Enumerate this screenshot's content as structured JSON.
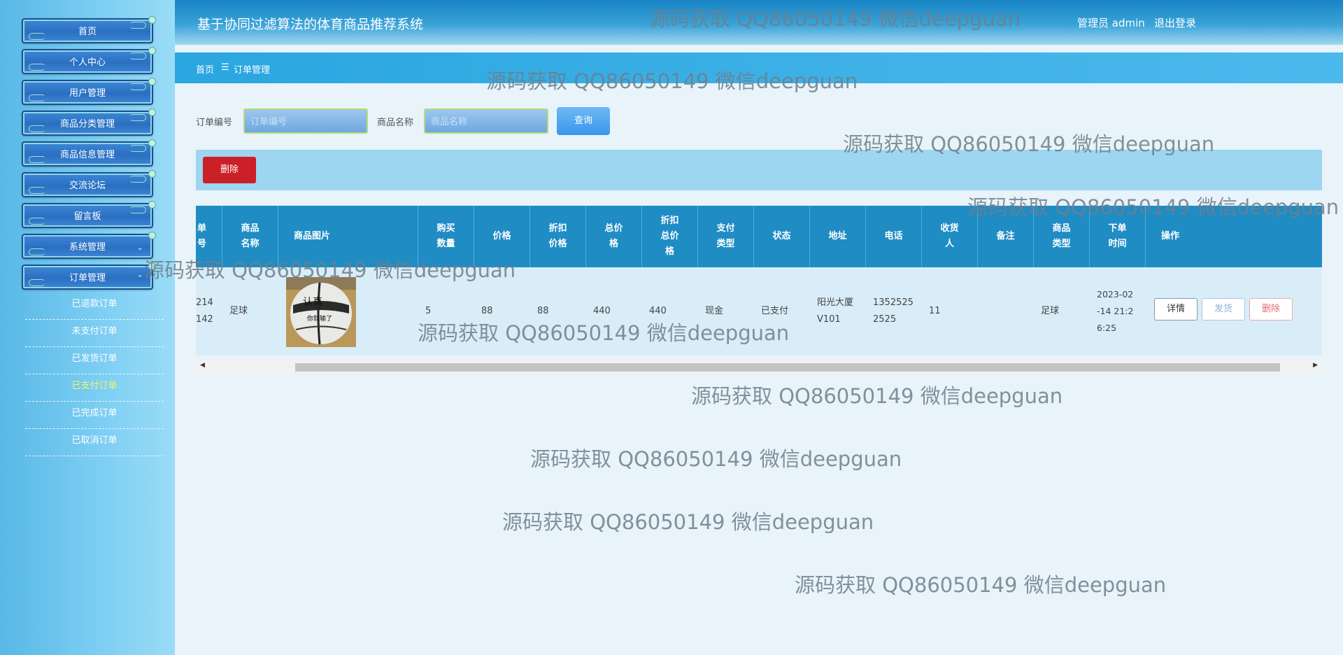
{
  "sidebar": {
    "menu": [
      "首页",
      "个人中心",
      "用户管理",
      "商品分类管理",
      "商品信息管理",
      "交流论坛",
      "留言板",
      "系统管理",
      "订单管理"
    ],
    "submenu": [
      "已退款订单",
      "未支付订单",
      "已发货订单",
      "已支付订单",
      "已完成订单",
      "已取消订单"
    ],
    "active_submenu": "已支付订单"
  },
  "header": {
    "title": "基于协同过滤算法的体育商品推荐系统",
    "admin": "管理员 admin",
    "logout": "退出登录"
  },
  "breadcrumb": {
    "home": "首页",
    "sep": "☰",
    "current": "订单管理"
  },
  "search": {
    "order_label": "订单编号",
    "order_placeholder": "订单编号",
    "product_label": "商品名称",
    "product_placeholder": "商品名称",
    "query": "查询"
  },
  "actions": {
    "delete": "删除"
  },
  "table": {
    "headers": [
      "单\n号",
      "商品\n名称",
      "商品图片",
      "购买\n数量",
      "价格",
      "折扣\n价格",
      "总价\n格",
      "折扣\n总价\n格",
      "支付\n类型",
      "状态",
      "地址",
      "电话",
      "收货\n人",
      "备注",
      "商品\n类型",
      "下单\n时间",
      "操作"
    ],
    "row": {
      "order_no": "214\n142",
      "name": "足球",
      "qty": "5",
      "price": "88",
      "disc_price": "88",
      "total": "440",
      "disc_total": "440",
      "pay_type": "现金",
      "status": "已支付",
      "address": "阳光大厦\nV101",
      "phone": "1352525\n2525",
      "receiver": "11",
      "remark": "",
      "category": "足球",
      "time": "2023-02\n-14 21:2\n6:25"
    },
    "ops": {
      "detail": "详情",
      "ship": "发货",
      "delete": "删除"
    }
  },
  "watermark": "源码获取 QQ86050149 微信deepguan"
}
